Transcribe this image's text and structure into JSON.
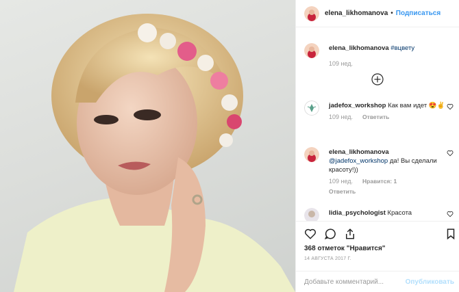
{
  "header": {
    "username": "elena_likhomanova",
    "separator": "•",
    "follow_label": "Подписаться"
  },
  "caption": {
    "username": "elena_likhomanova",
    "hashtag": "#вцвету",
    "time": "109 нед."
  },
  "comments": [
    {
      "username": "jadefox_workshop",
      "text": "Как вам идет",
      "emoji": "😍✌",
      "time": "109 нед.",
      "reply_label": "Ответить"
    },
    {
      "username": "elena_likhomanova",
      "mention": "@jadefox_workshop",
      "text": "да! Вы сделали красоту!))",
      "time": "109 нед.",
      "likes_label": "Нравится: 1",
      "reply_label": "Ответить"
    },
    {
      "username": "lidia_psychologist",
      "text": "Красота"
    }
  ],
  "post": {
    "likes": "368 отметок \"Нравится\"",
    "date": "14 АВГУСТА 2017 Г."
  },
  "comment_input": {
    "placeholder": "Добавьте комментарий...",
    "post_label": "Опубликовать"
  },
  "icons": [
    "heart-icon",
    "comment-icon",
    "share-icon",
    "bookmark-icon",
    "plus-circle-icon"
  ],
  "colors": {
    "link": "#3897f0",
    "hashtag": "#003569",
    "muted": "#999999",
    "post_disabled": "#b2dffc"
  }
}
